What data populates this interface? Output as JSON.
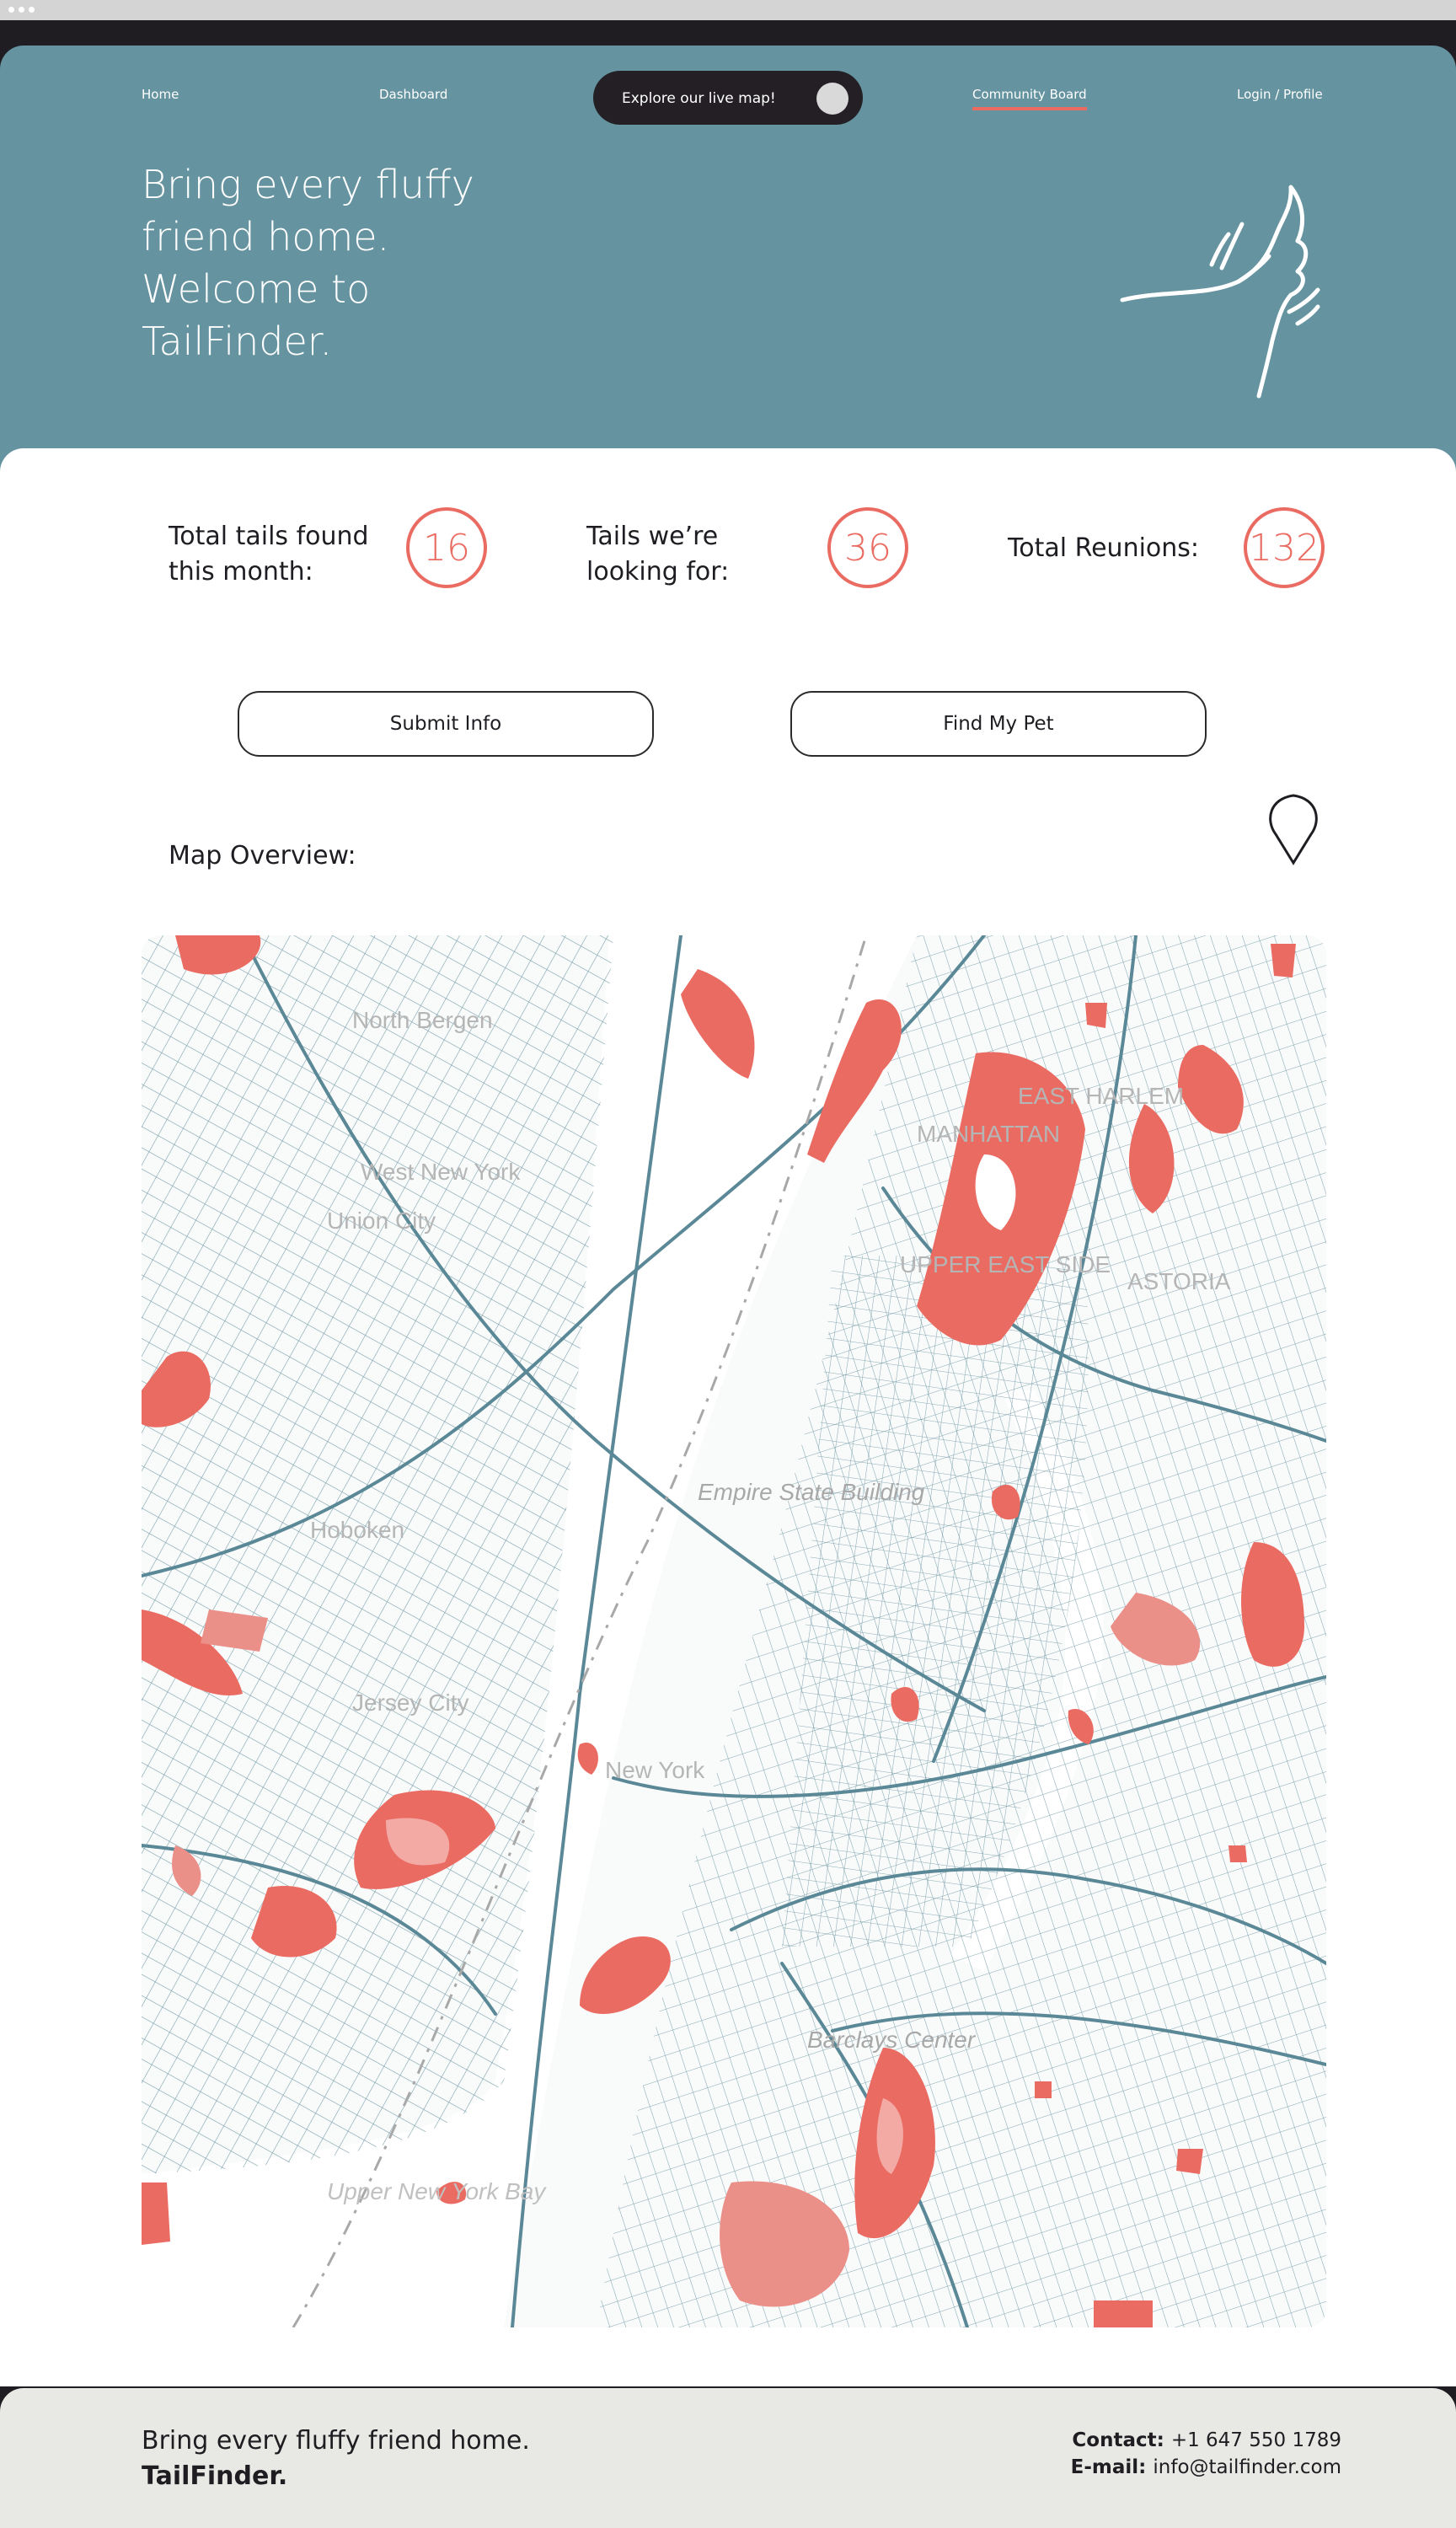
{
  "nav": {
    "home": "Home",
    "dashboard": "Dashboard",
    "live_map_toggle": "Explore our live map!",
    "community": "Community Board",
    "login": "Login / Profile"
  },
  "hero": {
    "line1": "Bring every fluffy",
    "line2": "friend home.",
    "line3": "Welcome to",
    "line4": "TailFinder."
  },
  "stats": [
    {
      "label_1": "Total tails found",
      "label_2": "this month:",
      "value": "16"
    },
    {
      "label_1": "Tails we’re",
      "label_2": "looking for:",
      "value": "36"
    },
    {
      "label_1": "Total Reunions:",
      "label_2": "",
      "value": "132"
    }
  ],
  "actions": {
    "submit": "Submit Info",
    "find": "Find My Pet"
  },
  "map": {
    "title": "Map Overview:",
    "labels": {
      "north_bergen": "North Bergen",
      "west_new_york": "West New York",
      "union_city": "Union City",
      "manhattan": "MANHATTAN",
      "east_harlem": "EAST HARLEM",
      "upper_east_side": "UPPER EAST SIDE",
      "astoria": "ASTORIA",
      "empire": "Empire State Building",
      "hoboken": "Hoboken",
      "jersey_city": "Jersey City",
      "new_york": "New York",
      "barclays": "Barclays Center",
      "upper_bay": "Upper New York Bay"
    }
  },
  "footer": {
    "tagline": "Bring every fluffy friend home.",
    "brand": "TailFinder.",
    "contact_label": "Contact:",
    "contact_value": "+1 647 550 1789",
    "email_label": "E-mail:",
    "email_value": "info@tailfinder.com"
  },
  "colors": {
    "accent": "#ea6b62",
    "hero_bg": "#6593a0",
    "street": "#5b8896",
    "footer_bg": "#e8e9e4"
  }
}
